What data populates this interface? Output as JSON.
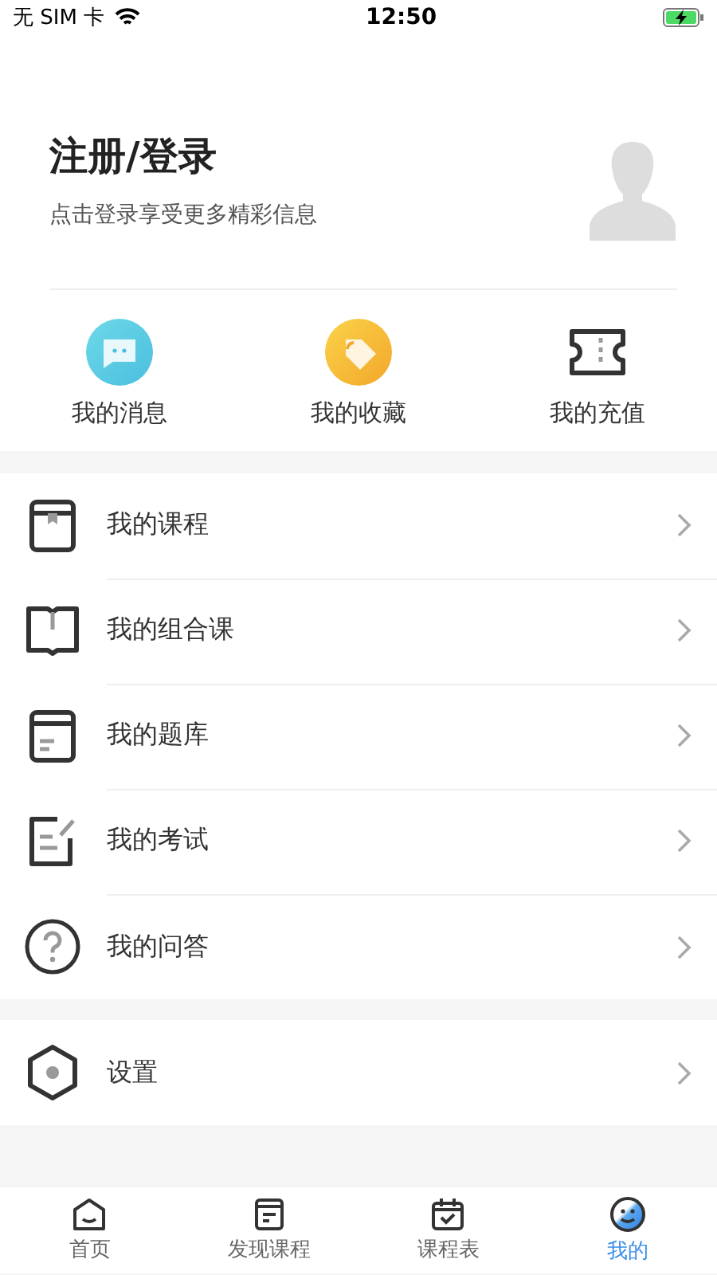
{
  "status_bar": {
    "carrier": "无 SIM 卡",
    "time": "12:50"
  },
  "profile": {
    "title": "注册/登录",
    "subtitle": "点击登录享受更多精彩信息"
  },
  "shortcuts": [
    {
      "kind": "message",
      "label": "我的消息"
    },
    {
      "kind": "favorite",
      "label": "我的收藏"
    },
    {
      "kind": "recharge",
      "label": "我的充值"
    }
  ],
  "menu": [
    {
      "kind": "course",
      "label": "我的课程"
    },
    {
      "kind": "book",
      "label": "我的组合课"
    },
    {
      "kind": "bank",
      "label": "我的题库"
    },
    {
      "kind": "exam",
      "label": "我的考试"
    },
    {
      "kind": "qa",
      "label": "我的问答"
    }
  ],
  "settings": [
    {
      "kind": "settings",
      "label": "设置"
    }
  ],
  "tab_bar": [
    {
      "kind": "home",
      "label": "首页",
      "selected": false
    },
    {
      "kind": "discover",
      "label": "发现课程",
      "selected": false
    },
    {
      "kind": "schedule",
      "label": "课程表",
      "selected": false
    },
    {
      "kind": "me",
      "label": "我的",
      "selected": true
    }
  ]
}
